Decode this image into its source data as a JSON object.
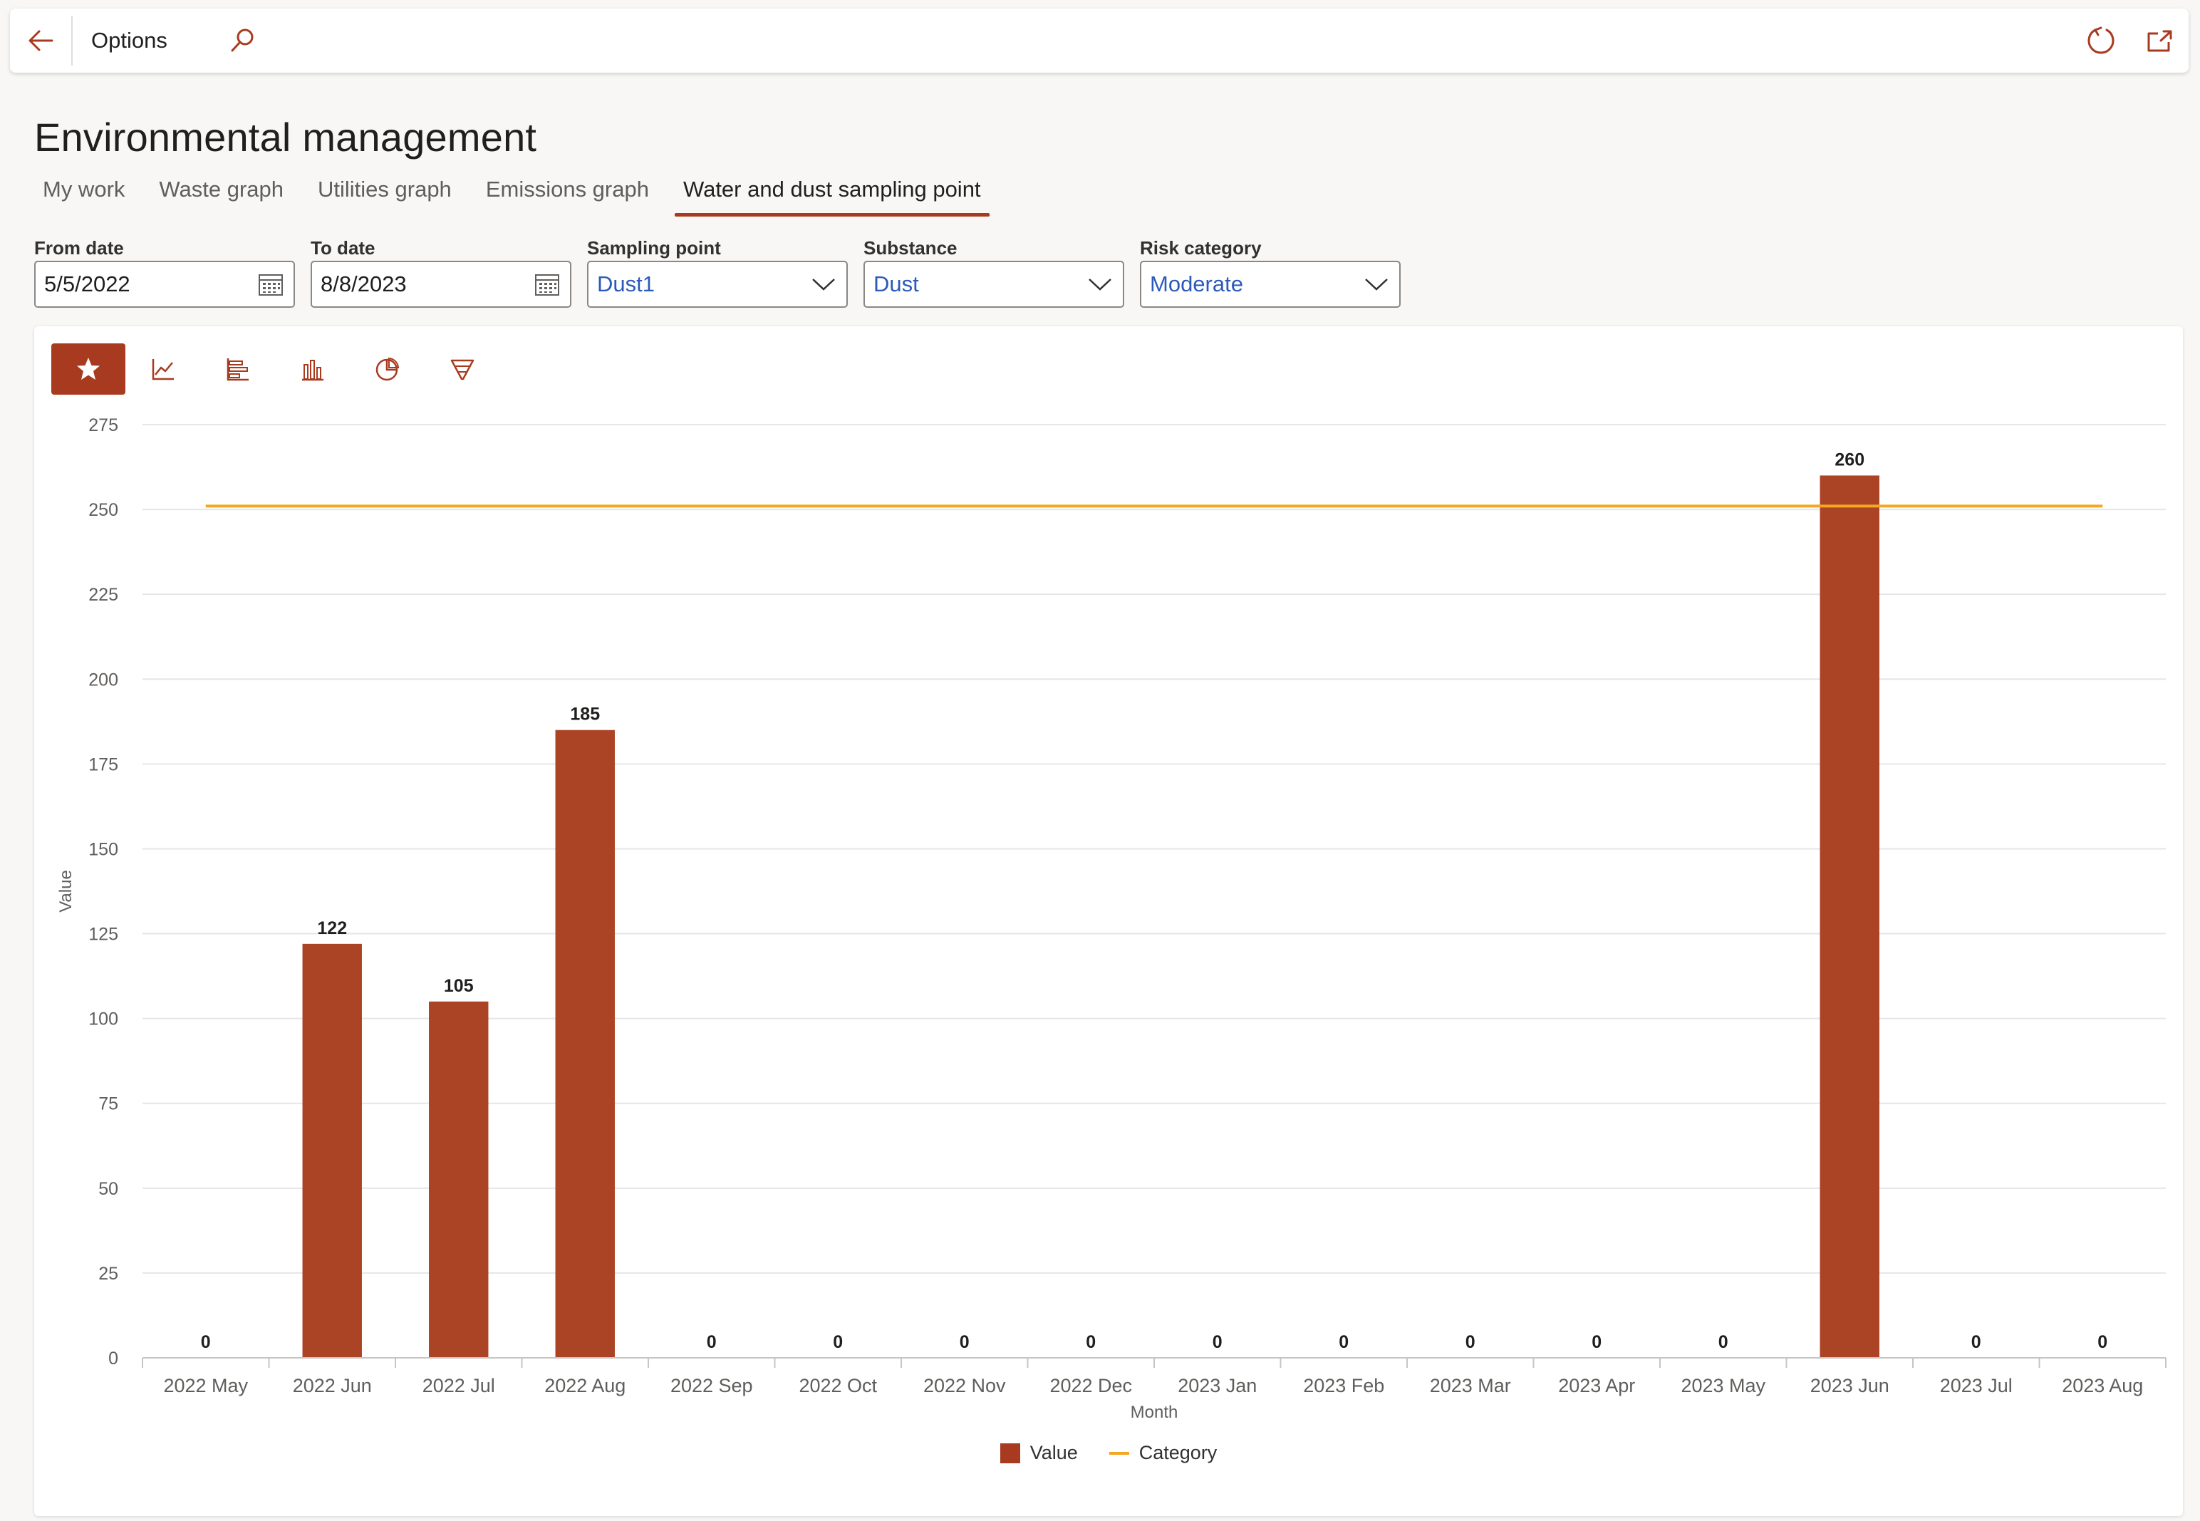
{
  "topbar": {
    "options_label": "Options"
  },
  "page": {
    "title": "Environmental management"
  },
  "tabs": [
    {
      "label": "My work",
      "active": false
    },
    {
      "label": "Waste graph",
      "active": false
    },
    {
      "label": "Utilities graph",
      "active": false
    },
    {
      "label": "Emissions graph",
      "active": false
    },
    {
      "label": "Water and dust sampling point",
      "active": true
    }
  ],
  "filters": {
    "from_date": {
      "label": "From date",
      "value": "5/5/2022"
    },
    "to_date": {
      "label": "To date",
      "value": "8/8/2023"
    },
    "sampling_point": {
      "label": "Sampling point",
      "value": "Dust1"
    },
    "substance": {
      "label": "Substance",
      "value": "Dust"
    },
    "risk_category": {
      "label": "Risk category",
      "value": "Moderate"
    }
  },
  "colors": {
    "accent": "#a83b1f",
    "bar": "#ab4325",
    "category_line": "#f5a623",
    "link": "#2b5aba"
  },
  "chart_data": {
    "type": "bar",
    "categories": [
      "2022 May",
      "2022 Jun",
      "2022 Jul",
      "2022 Aug",
      "2022 Sep",
      "2022 Oct",
      "2022 Nov",
      "2022 Dec",
      "2023 Jan",
      "2023 Feb",
      "2023 Mar",
      "2023 Apr",
      "2023 May",
      "2023 Jun",
      "2023 Jul",
      "2023 Aug"
    ],
    "series": [
      {
        "name": "Value",
        "type": "bar",
        "values": [
          0,
          122,
          105,
          185,
          0,
          0,
          0,
          0,
          0,
          0,
          0,
          0,
          0,
          260,
          0,
          0
        ]
      },
      {
        "name": "Category",
        "type": "line",
        "values": [
          251,
          251,
          251,
          251,
          251,
          251,
          251,
          251,
          251,
          251,
          251,
          251,
          251,
          251,
          251,
          251
        ]
      }
    ],
    "xlabel": "Month",
    "ylabel": "Value",
    "ylim": [
      0,
      275
    ],
    "yticks": [
      0,
      25,
      50,
      75,
      100,
      125,
      150,
      175,
      200,
      225,
      250,
      275
    ],
    "grid": true,
    "legend": "bottom-center"
  }
}
